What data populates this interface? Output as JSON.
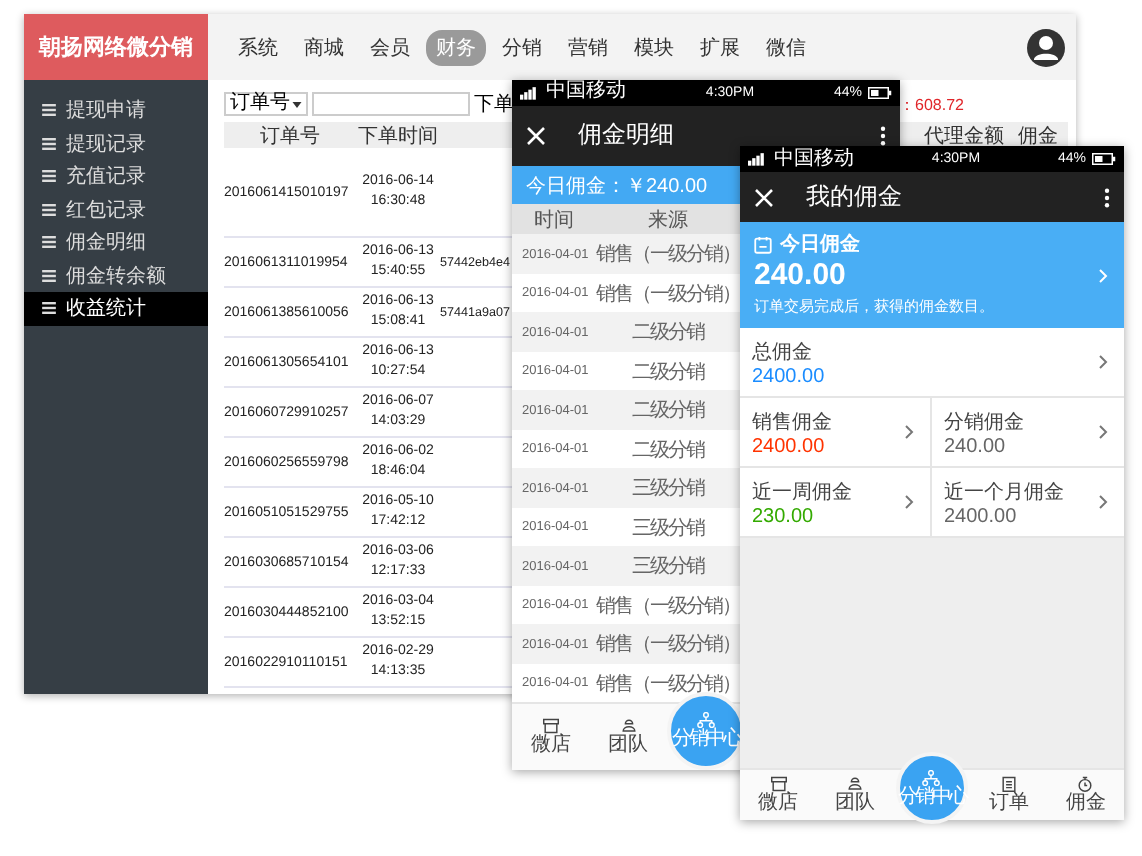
{
  "desktop": {
    "logo": "朝扬网络微分销",
    "nav": [
      {
        "label": "系统",
        "selected": false
      },
      {
        "label": "商城",
        "selected": false
      },
      {
        "label": "会员",
        "selected": false
      },
      {
        "label": "财务",
        "selected": true
      },
      {
        "label": "分销",
        "selected": false
      },
      {
        "label": "营销",
        "selected": false
      },
      {
        "label": "模块",
        "selected": false
      },
      {
        "label": "扩展",
        "selected": false
      },
      {
        "label": "微信",
        "selected": false
      }
    ],
    "sidebar": [
      {
        "label": "提现申请",
        "selected": false
      },
      {
        "label": "提现记录",
        "selected": false
      },
      {
        "label": "充值记录",
        "selected": false
      },
      {
        "label": "红包记录",
        "selected": false
      },
      {
        "label": "佣金明细",
        "selected": false
      },
      {
        "label": "佣金转余额",
        "selected": false
      },
      {
        "label": "收益统计",
        "selected": true
      }
    ],
    "filter": {
      "select": "订单号",
      "date_label": "下单",
      "total": "：608.72"
    },
    "columns": [
      "订单号",
      "下单时间",
      "代理金额",
      "佣金"
    ],
    "rows": [
      {
        "order": "2016061415010197",
        "date": "2016-06-14",
        "time": "16:30:48"
      },
      {
        "order": "2016061311019954",
        "date": "2016-06-13",
        "time": "15:40:55",
        "column_3": "57442eb4e4"
      },
      {
        "order": "2016061385610056",
        "date": "2016-06-13",
        "time": "15:08:41",
        "column_3": "57441a9a07"
      },
      {
        "order": "2016061305654101",
        "date": "2016-06-13",
        "time": "10:27:54"
      },
      {
        "order": "2016060729910257",
        "date": "2016-06-07",
        "time": "14:03:29"
      },
      {
        "order": "2016060256559798",
        "date": "2016-06-02",
        "time": "18:46:04"
      },
      {
        "order": "2016051051529755",
        "date": "2016-05-10",
        "time": "17:42:12"
      },
      {
        "order": "2016030685710154",
        "date": "2016-03-06",
        "time": "12:17:33"
      },
      {
        "order": "2016030444852100",
        "date": "2016-03-04",
        "time": "13:52:15"
      },
      {
        "order": "2016022910110151",
        "date": "2016-02-29",
        "time": "14:13:35"
      }
    ]
  },
  "phone_detail": {
    "status": {
      "carrier": "中国移动",
      "clock": "4:30PM",
      "battery": "44%"
    },
    "title": "佣金明细",
    "today": "今日佣金：￥240.00",
    "columns": [
      "时间",
      "来源"
    ],
    "rows": [
      {
        "date": "2016-04-01",
        "source": "销售（一级分销）"
      },
      {
        "date": "2016-04-01",
        "source": "销售（一级分销）"
      },
      {
        "date": "2016-04-01",
        "source": "二级分销"
      },
      {
        "date": "2016-04-01",
        "source": "二级分销"
      },
      {
        "date": "2016-04-01",
        "source": "二级分销"
      },
      {
        "date": "2016-04-01",
        "source": "二级分销"
      },
      {
        "date": "2016-04-01",
        "source": "三级分销"
      },
      {
        "date": "2016-04-01",
        "source": "三级分销"
      },
      {
        "date": "2016-04-01",
        "source": "三级分销"
      },
      {
        "date": "2016-04-01",
        "source": "销售（一级分销）"
      },
      {
        "date": "2016-04-01",
        "source": "销售（一级分销）"
      },
      {
        "date": "2016-04-01",
        "source": "销售（一级分销）"
      }
    ],
    "tabs": [
      {
        "label": "微店",
        "kind": "shop"
      },
      {
        "label": "团队",
        "kind": "team"
      },
      {
        "label": "分销中心",
        "kind": "center"
      }
    ]
  },
  "phone_mine": {
    "status": {
      "carrier": "中国移动",
      "clock": "4:30PM",
      "battery": "44%"
    },
    "title": "我的佣金",
    "today": {
      "label": "今日佣金",
      "amount": "240.00",
      "note": "订单交易完成后，获得的佣金数目。"
    },
    "stats": [
      {
        "label": "总佣金",
        "amount": "2400.00",
        "color": "#1a8cff",
        "kind": "wide"
      },
      {
        "label": "销售佣金",
        "amount": "2400.00",
        "color": "#ff3300",
        "kind": "half"
      },
      {
        "label": "分销佣金",
        "amount": "240.00",
        "color": "#666666",
        "kind": "half"
      },
      {
        "label": "近一周佣金",
        "amount": "230.00",
        "color": "#33aa00",
        "kind": "half"
      },
      {
        "label": "近一个月佣金",
        "amount": "2400.00",
        "color": "#666666",
        "kind": "half"
      }
    ],
    "tabs": [
      {
        "label": "微店",
        "kind": "shop"
      },
      {
        "label": "团队",
        "kind": "team"
      },
      {
        "label": "分销中心",
        "kind": "center"
      },
      {
        "label": "订单",
        "kind": "order"
      },
      {
        "label": "佣金",
        "kind": "wallet"
      }
    ]
  }
}
